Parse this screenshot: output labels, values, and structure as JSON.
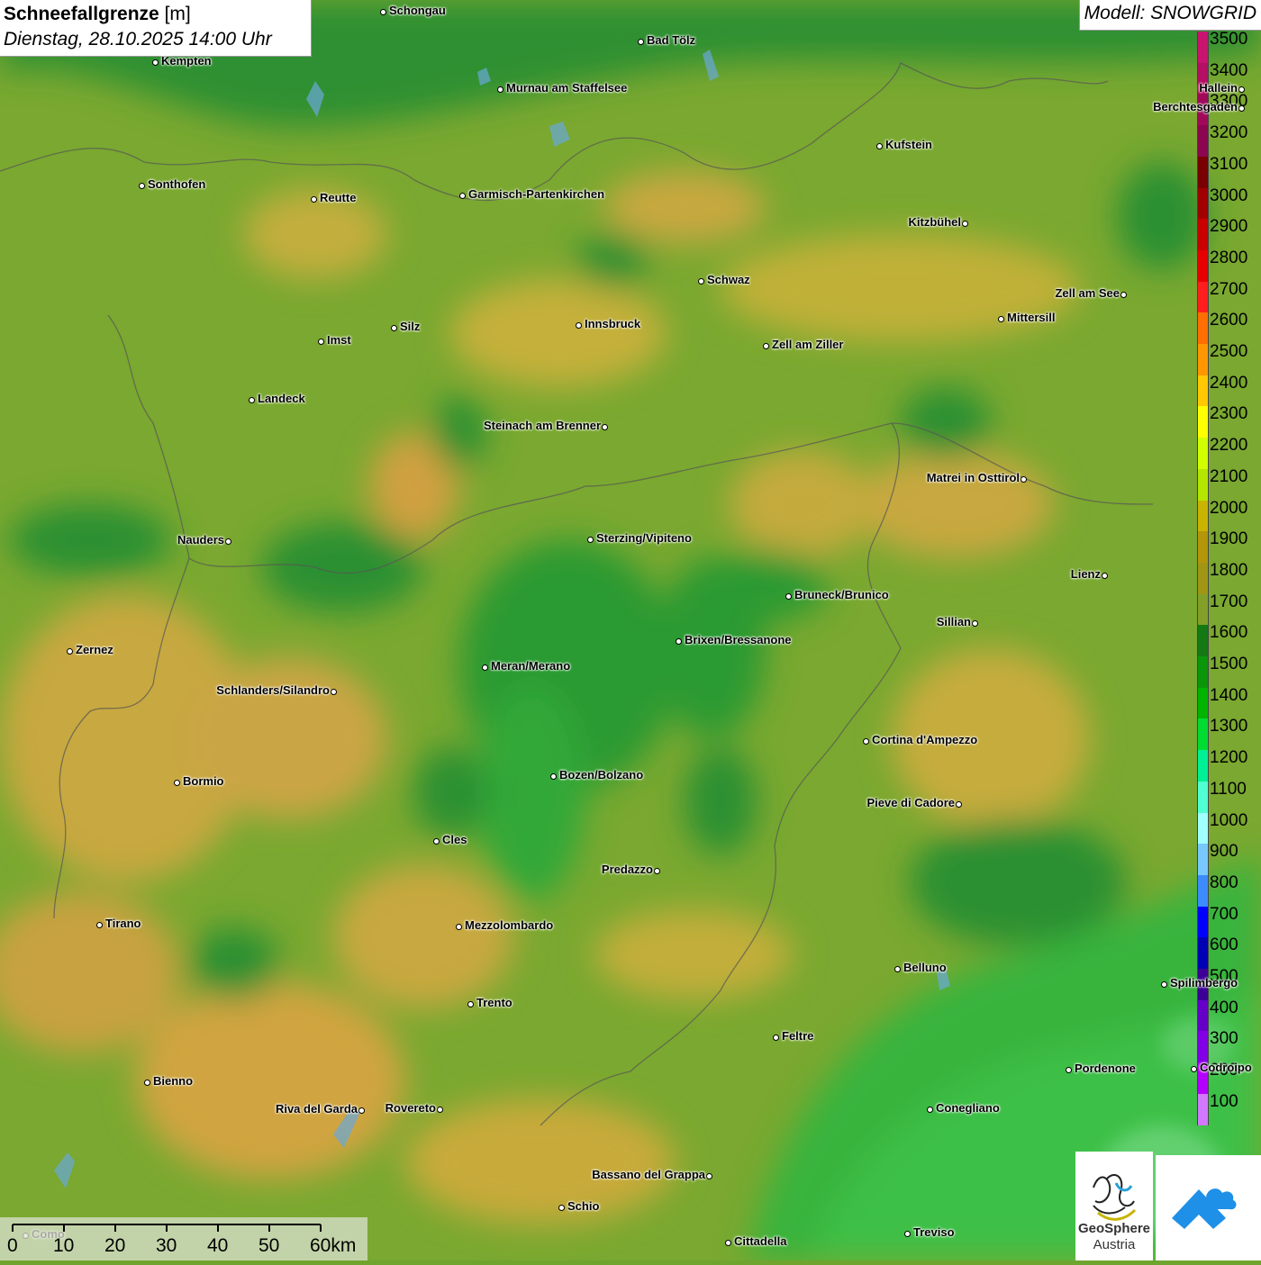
{
  "title": {
    "bold": "Schneefallgrenze",
    "unit": " [m]",
    "datetime": "Dienstag, 28.10.2025 14:00 Uhr"
  },
  "model": "Modell: SNOWGRID",
  "legend": {
    "labels": [
      "3500",
      "3400",
      "3300",
      "3200",
      "3100",
      "3000",
      "2900",
      "2800",
      "2700",
      "2600",
      "2500",
      "2400",
      "2300",
      "2200",
      "2100",
      "2000",
      "1900",
      "1800",
      "1700",
      "1600",
      "1500",
      "1400",
      "1300",
      "1200",
      "1100",
      "1000",
      "900",
      "800",
      "700",
      "600",
      "500",
      "400",
      "300",
      "200",
      "100"
    ],
    "colors": [
      "#c8146e",
      "#b40f64",
      "#a0095a",
      "#8c0550",
      "#780000",
      "#a00000",
      "#c80000",
      "#e60000",
      "#ff1e1e",
      "#ff6e00",
      "#ff9600",
      "#ffc800",
      "#ffff00",
      "#d2ff00",
      "#b4e600",
      "#c8b400",
      "#b4960a",
      "#a09614",
      "#82a028",
      "#147814",
      "#0a960a",
      "#00b400",
      "#00dc32",
      "#00f096",
      "#50ffd2",
      "#a0ffff",
      "#78c8ff",
      "#3c8cff",
      "#0000ff",
      "#0000b4",
      "#3c0096",
      "#6400c8",
      "#8200e6",
      "#b400ff",
      "#d278ff"
    ]
  },
  "cities": [
    {
      "name": "Schongau"
    },
    {
      "name": "Bad Tölz"
    },
    {
      "name": "Kempten"
    },
    {
      "name": "Murnau am Staffelsee"
    },
    {
      "name": "Berchtesgaden"
    },
    {
      "name": "Hallein"
    },
    {
      "name": "Kufstein"
    },
    {
      "name": "Sonthofen"
    },
    {
      "name": "Reutte"
    },
    {
      "name": "Garmisch-Partenkirchen"
    },
    {
      "name": "Kitzbühel"
    },
    {
      "name": "Schwaz"
    },
    {
      "name": "Zell am See"
    },
    {
      "name": "Mittersill"
    },
    {
      "name": "Innsbruck"
    },
    {
      "name": "Silz"
    },
    {
      "name": "Imst"
    },
    {
      "name": "Zell am Ziller"
    },
    {
      "name": "Landeck"
    },
    {
      "name": "Steinach am Brenner"
    },
    {
      "name": "Matrei in Osttirol"
    },
    {
      "name": "Nauders"
    },
    {
      "name": "Sterzing/Vipiteno"
    },
    {
      "name": "Lienz"
    },
    {
      "name": "Bruneck/Brunico"
    },
    {
      "name": "Sillian"
    },
    {
      "name": "Zernez"
    },
    {
      "name": "Brixen/Bressanone"
    },
    {
      "name": "Meran/Merano"
    },
    {
      "name": "Schlanders/Silandro"
    },
    {
      "name": "Cortina d'Ampezzo"
    },
    {
      "name": "Bozen/Bolzano"
    },
    {
      "name": "Bormio"
    },
    {
      "name": "Pieve di Cadore"
    },
    {
      "name": "Cles"
    },
    {
      "name": "Predazzo"
    },
    {
      "name": "Tirano"
    },
    {
      "name": "Mezzolombardo"
    },
    {
      "name": "Belluno"
    },
    {
      "name": "Spilimbergo"
    },
    {
      "name": "Trento"
    },
    {
      "name": "Feltre"
    },
    {
      "name": "Pordenone"
    },
    {
      "name": "Codroipo"
    },
    {
      "name": "Bienno"
    },
    {
      "name": "Riva del Garda"
    },
    {
      "name": "Rovereto"
    },
    {
      "name": "Conegliano"
    },
    {
      "name": "Bassano del Grappa"
    },
    {
      "name": "Schio"
    },
    {
      "name": "Treviso"
    },
    {
      "name": "Cittadella"
    },
    {
      "name": "Como"
    }
  ],
  "scale": {
    "labels": [
      "0",
      "10",
      "20",
      "30",
      "40",
      "50",
      "60km"
    ]
  },
  "logo": {
    "geo_line1": "GeoSphere",
    "geo_line2": "Austria"
  }
}
